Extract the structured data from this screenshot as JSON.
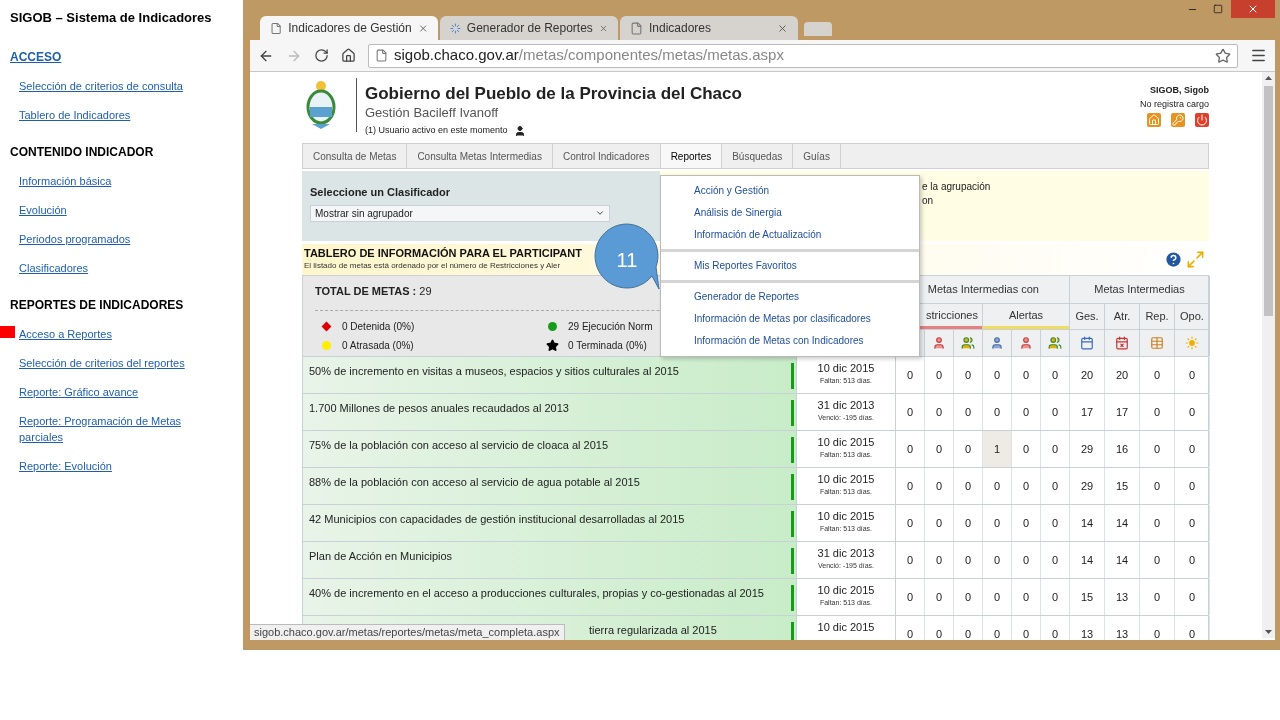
{
  "sidebar": {
    "title": "SIGOB – Sistema de Indicadores",
    "sections": [
      {
        "title": "ACCESO",
        "kind": "link",
        "items": [
          {
            "label": "Selección de criterios de consulta",
            "selected": false
          },
          {
            "label": "Tablero de Indicadores",
            "selected": false
          }
        ]
      },
      {
        "title": "CONTENIDO INDICADOR",
        "kind": "heading",
        "items": [
          {
            "label": "Información básica",
            "selected": false
          },
          {
            "label": "Evolución",
            "selected": false
          },
          {
            "label": "Periodos programados",
            "selected": false
          },
          {
            "label": "Clasificadores",
            "selected": false
          }
        ]
      },
      {
        "title": "REPORTES DE INDICADORES",
        "kind": "heading",
        "items": [
          {
            "label": "Acceso a Reportes",
            "selected": true
          },
          {
            "label": "Selección de criterios del reportes",
            "selected": false
          },
          {
            "label": "Reporte: Gráfico avance",
            "selected": false
          },
          {
            "label": "Reporte: Programación de Metas parciales",
            "selected": false
          },
          {
            "label": "Reporte: Evolución",
            "selected": false
          }
        ]
      }
    ]
  },
  "browser": {
    "tabs": [
      {
        "title": "Indicadores de Gestión",
        "selected": true,
        "loading": false
      },
      {
        "title": "Generador de Reportes",
        "selected": false,
        "loading": true
      },
      {
        "title": "Indicadores",
        "selected": false,
        "loading": false
      }
    ],
    "url": {
      "host": "sigob.chaco.gov.ar",
      "path": "/metas/componentes/metas/metas.aspx"
    },
    "status_text": "sigob.chaco.gov.ar/metas/reportes/metas/meta_completa.aspx"
  },
  "header": {
    "title": "Gobierno del Pueblo de la Provincia del Chaco",
    "subtitle": "Gestión Bacileff Ivanoff",
    "active_users": "(1) Usuario activo en este momento",
    "user_name": "SIGOB, Sigob",
    "user_role": "No registra cargo"
  },
  "nav": [
    {
      "label": "Consulta de Metas",
      "selected": false
    },
    {
      "label": "Consulta Metas Intermedias",
      "selected": false
    },
    {
      "label": "Control Indicadores",
      "selected": false
    },
    {
      "label": "Reportes",
      "selected": true
    },
    {
      "label": "Búsquedas",
      "selected": false
    },
    {
      "label": "Guías",
      "selected": false
    }
  ],
  "classifier": {
    "label": "Seleccione un Clasificador",
    "value": "Mostrar sin agrupador",
    "note_lines": [
      "e la agrupación",
      "on"
    ]
  },
  "menu": {
    "groups": [
      {
        "items": [
          "Acción y Gestión",
          "Análisis de Sinergia",
          "Información de Actualización"
        ]
      },
      {
        "items": [
          "Mis Reportes Favoritos"
        ]
      },
      {
        "items": [
          "Generador de Reportes",
          "Información de Metas por clasificadores",
          "Información de Metas con Indicadores"
        ]
      }
    ]
  },
  "callout": {
    "label": "11"
  },
  "board": {
    "title": "TABLERO DE INFORMACIÓN PARA EL PARTICIPANT",
    "subtitle": "El listado de metas está ordenado por el número de Restricciones y Aler"
  },
  "table": {
    "total_label": "TOTAL DE METAS :",
    "total": "29",
    "legend": [
      {
        "text": "0 Detenida (0%)",
        "kind": "diamond",
        "color": "#e00000"
      },
      {
        "text": "29 Ejecución Norm",
        "kind": "dot",
        "color": "#1a9a1a"
      },
      {
        "text": "0 Atrasada (0%)",
        "kind": "dot",
        "color": "#ffee00"
      },
      {
        "text": "0 Terminada (0%)",
        "kind": "star",
        "color": "#000000"
      }
    ],
    "groups": [
      {
        "label": "Metas Intermedias con"
      },
      {
        "label": "Metas Intermedias"
      }
    ],
    "subgroups": [
      {
        "label": "stricciones",
        "color": "#e88080"
      },
      {
        "label": "Alertas",
        "color": "#f0dc60"
      },
      {
        "label": "Ges."
      },
      {
        "label": "Atr."
      },
      {
        "label": "Rep."
      },
      {
        "label": "Opo."
      }
    ],
    "rows": [
      {
        "meta": "50% de incremento en visitas a museos, espacios y sitios culturales al 2015",
        "covered": false,
        "color": "#1a9a1a",
        "date": "10 dic 2015",
        "remaining": "Faltan: 513 días.",
        "cells": [
          {
            "value": "0",
            "flagged": false
          },
          {
            "value": "0",
            "flagged": false
          },
          {
            "value": "0",
            "flagged": false
          },
          {
            "value": "0",
            "flagged": false
          },
          {
            "value": "0",
            "flagged": false
          },
          {
            "value": "0",
            "flagged": false
          },
          {
            "value": "20",
            "flagged": false
          },
          {
            "value": "20",
            "flagged": false
          },
          {
            "value": "0",
            "flagged": false
          },
          {
            "value": "0",
            "flagged": false
          }
        ]
      },
      {
        "meta": "1.700 Millones de pesos anuales recaudados al 2013",
        "covered": false,
        "color": "#1a9a1a",
        "date": "31 dic 2013",
        "remaining": "Venció: -195 días.",
        "cells": [
          {
            "value": "0",
            "flagged": false
          },
          {
            "value": "0",
            "flagged": false
          },
          {
            "value": "0",
            "flagged": false
          },
          {
            "value": "0",
            "flagged": false
          },
          {
            "value": "0",
            "flagged": false
          },
          {
            "value": "0",
            "flagged": false
          },
          {
            "value": "17",
            "flagged": false
          },
          {
            "value": "17",
            "flagged": false
          },
          {
            "value": "0",
            "flagged": false
          },
          {
            "value": "0",
            "flagged": false
          }
        ]
      },
      {
        "meta": "75% de la población con acceso al servicio de cloaca al 2015",
        "covered": false,
        "color": "#1a9a1a",
        "date": "10 dic 2015",
        "remaining": "Faltan: 513 días.",
        "cells": [
          {
            "value": "0",
            "flagged": false
          },
          {
            "value": "0",
            "flagged": false
          },
          {
            "value": "0",
            "flagged": false
          },
          {
            "value": "1",
            "flagged": true
          },
          {
            "value": "0",
            "flagged": false
          },
          {
            "value": "0",
            "flagged": false
          },
          {
            "value": "29",
            "flagged": false
          },
          {
            "value": "16",
            "flagged": false
          },
          {
            "value": "0",
            "flagged": false
          },
          {
            "value": "0",
            "flagged": false
          }
        ]
      },
      {
        "meta": "88% de la población con acceso al servicio de agua potable al 2015",
        "covered": false,
        "color": "#1a9a1a",
        "date": "10 dic 2015",
        "remaining": "Faltan: 513 días.",
        "cells": [
          {
            "value": "0",
            "flagged": false
          },
          {
            "value": "0",
            "flagged": false
          },
          {
            "value": "0",
            "flagged": false
          },
          {
            "value": "0",
            "flagged": false
          },
          {
            "value": "0",
            "flagged": false
          },
          {
            "value": "0",
            "flagged": false
          },
          {
            "value": "29",
            "flagged": false
          },
          {
            "value": "15",
            "flagged": false
          },
          {
            "value": "0",
            "flagged": false
          },
          {
            "value": "0",
            "flagged": false
          }
        ]
      },
      {
        "meta": "42 Municipios con capacidades de gestión institucional desarrolladas al 2015",
        "covered": false,
        "color": "#1a9a1a",
        "date": "10 dic 2015",
        "remaining": "Faltan: 513 días.",
        "cells": [
          {
            "value": "0",
            "flagged": false
          },
          {
            "value": "0",
            "flagged": false
          },
          {
            "value": "0",
            "flagged": false
          },
          {
            "value": "0",
            "flagged": false
          },
          {
            "value": "0",
            "flagged": false
          },
          {
            "value": "0",
            "flagged": false
          },
          {
            "value": "14",
            "flagged": false
          },
          {
            "value": "14",
            "flagged": false
          },
          {
            "value": "0",
            "flagged": false
          },
          {
            "value": "0",
            "flagged": false
          }
        ]
      },
      {
        "meta": "Plan de Acción en Municipios",
        "covered": false,
        "color": "#1a9a1a",
        "date": "31 dic 2013",
        "remaining": "Venció: -195 días.",
        "cells": [
          {
            "value": "0",
            "flagged": false
          },
          {
            "value": "0",
            "flagged": false
          },
          {
            "value": "0",
            "flagged": false
          },
          {
            "value": "0",
            "flagged": false
          },
          {
            "value": "0",
            "flagged": false
          },
          {
            "value": "0",
            "flagged": false
          },
          {
            "value": "14",
            "flagged": false
          },
          {
            "value": "14",
            "flagged": false
          },
          {
            "value": "0",
            "flagged": false
          },
          {
            "value": "0",
            "flagged": false
          }
        ]
      },
      {
        "meta": "40% de incremento en el acceso a producciones culturales, propias y co-gestionadas al 2015",
        "covered": false,
        "color": "#1a9a1a",
        "date": "10 dic 2015",
        "remaining": "Faltan: 513 días.",
        "cells": [
          {
            "value": "0",
            "flagged": false
          },
          {
            "value": "0",
            "flagged": false
          },
          {
            "value": "0",
            "flagged": false
          },
          {
            "value": "0",
            "flagged": false
          },
          {
            "value": "0",
            "flagged": false
          },
          {
            "value": "0",
            "flagged": false
          },
          {
            "value": "15",
            "flagged": false
          },
          {
            "value": "13",
            "flagged": false
          },
          {
            "value": "0",
            "flagged": false
          },
          {
            "value": "0",
            "flagged": false
          }
        ]
      },
      {
        "meta": "tierra regularizada al 2015",
        "covered": true,
        "color": "#1a9a1a",
        "date": "10 dic 2015",
        "cells": [
          {
            "value": "0",
            "flagged": false
          },
          {
            "value": "0",
            "flagged": false
          },
          {
            "value": "0",
            "flagged": false
          },
          {
            "value": "0",
            "flagged": false
          },
          {
            "value": "0",
            "flagged": false
          },
          {
            "value": "0",
            "flagged": false
          },
          {
            "value": "13",
            "flagged": false
          },
          {
            "value": "13",
            "flagged": false
          },
          {
            "value": "0",
            "flagged": false
          },
          {
            "value": "0",
            "flagged": false
          }
        ]
      }
    ]
  }
}
